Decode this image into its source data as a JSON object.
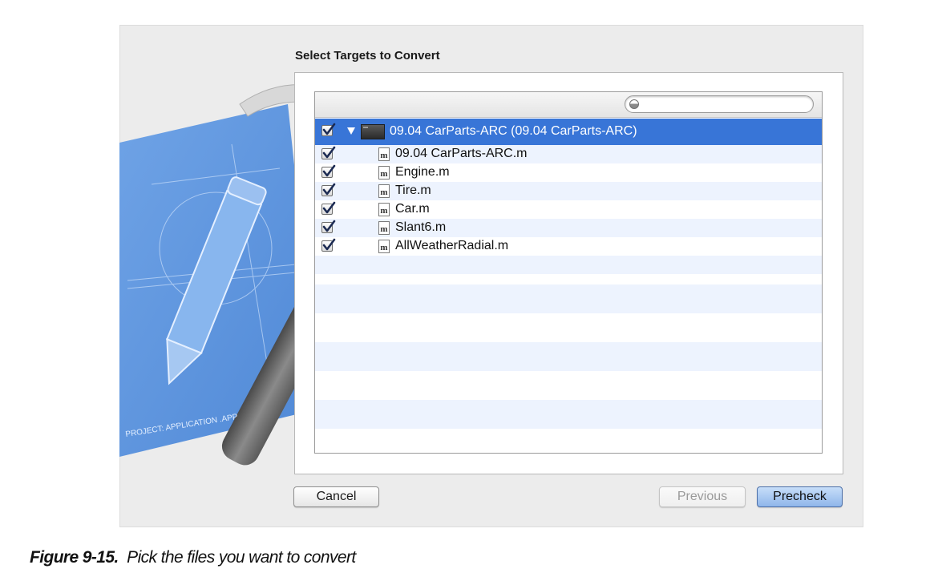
{
  "dialog": {
    "heading": "Select Targets to Convert",
    "search": {
      "placeholder": ""
    },
    "target": {
      "checked": true,
      "label": "09.04 CarParts-ARC (09.04 CarParts-ARC)"
    },
    "files": [
      {
        "icon": "m",
        "label": "09.04 CarParts-ARC.m",
        "checked": true
      },
      {
        "icon": "m",
        "label": "Engine.m",
        "checked": true
      },
      {
        "icon": "m",
        "label": "Tire.m",
        "checked": true
      },
      {
        "icon": "m",
        "label": "Car.m",
        "checked": true
      },
      {
        "icon": "m",
        "label": "Slant6.m",
        "checked": true
      },
      {
        "icon": "m",
        "label": "AllWeatherRadial.m",
        "checked": true
      }
    ],
    "buttons": {
      "cancel": "Cancel",
      "previous": "Previous",
      "precheck": "Precheck"
    }
  },
  "artwork": {
    "project_label": "PROJECT: APPLICATION .APP"
  },
  "caption": {
    "figure": "Figure 9-15.",
    "text": "Pick the files you want to convert"
  },
  "colors": {
    "selection": "#3875d7",
    "alt_row": "#edf3fe",
    "default_button": "#8fb6ea",
    "blueprint": "#5b93dc"
  }
}
